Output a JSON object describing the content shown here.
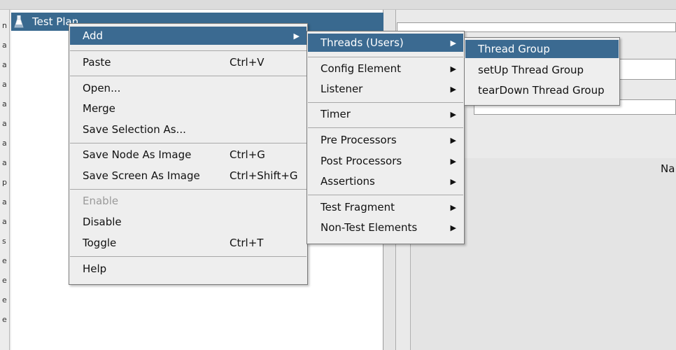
{
  "tree": {
    "root_label": "Test Plan"
  },
  "context_menu": {
    "items": [
      {
        "label": "Add",
        "shortcut": ""
      },
      {
        "label": "Paste",
        "shortcut": "Ctrl+V"
      },
      {
        "label": "Open...",
        "shortcut": ""
      },
      {
        "label": "Merge",
        "shortcut": ""
      },
      {
        "label": "Save Selection As...",
        "shortcut": ""
      },
      {
        "label": "Save Node As Image",
        "shortcut": "Ctrl+G"
      },
      {
        "label": "Save Screen As Image",
        "shortcut": "Ctrl+Shift+G"
      },
      {
        "label": "Enable",
        "shortcut": ""
      },
      {
        "label": "Disable",
        "shortcut": ""
      },
      {
        "label": "Toggle",
        "shortcut": "Ctrl+T"
      },
      {
        "label": "Help",
        "shortcut": ""
      }
    ]
  },
  "add_submenu": {
    "items": [
      {
        "label": "Threads (Users)"
      },
      {
        "label": "Config Element"
      },
      {
        "label": "Listener"
      },
      {
        "label": "Timer"
      },
      {
        "label": "Pre Processors"
      },
      {
        "label": "Post Processors"
      },
      {
        "label": "Assertions"
      },
      {
        "label": "Test Fragment"
      },
      {
        "label": "Non-Test Elements"
      }
    ]
  },
  "threads_submenu": {
    "items": [
      {
        "label": "Thread Group"
      },
      {
        "label": "setUp Thread Group"
      },
      {
        "label": "tearDown Thread Group"
      }
    ]
  },
  "right_panel": {
    "partial_label": "Na"
  },
  "left_strip_chars": [
    "n",
    "a",
    "a",
    "a",
    "a",
    "a",
    "a",
    "a",
    "p",
    "a",
    "a",
    "s",
    "e",
    "e",
    "e",
    "e"
  ],
  "colors": {
    "selection": "#3b6a91",
    "menu_bg": "#eeeeee",
    "tree_selection": "#39698f"
  }
}
